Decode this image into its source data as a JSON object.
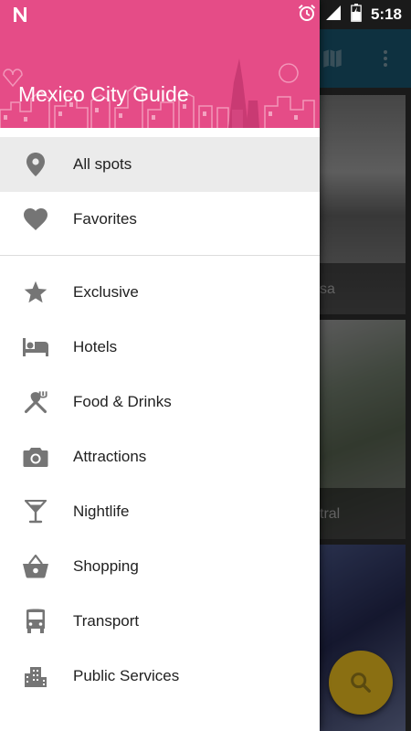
{
  "status_bar": {
    "time": "5:18",
    "icons": [
      "n-notification-icon",
      "alarm-icon",
      "signal-icon",
      "battery-icon"
    ]
  },
  "drawer": {
    "header_color": "#e54c87",
    "title": "Mexico City Guide",
    "primary_items": [
      {
        "label": "All spots",
        "icon": "location-pin-icon",
        "selected": true
      },
      {
        "label": "Favorites",
        "icon": "heart-icon",
        "selected": false
      }
    ],
    "category_items": [
      {
        "label": "Exclusive",
        "icon": "star-icon"
      },
      {
        "label": "Hotels",
        "icon": "bed-icon"
      },
      {
        "label": "Food & Drinks",
        "icon": "utensils-icon"
      },
      {
        "label": "Attractions",
        "icon": "camera-icon"
      },
      {
        "label": "Nightlife",
        "icon": "cocktail-icon"
      },
      {
        "label": "Shopping",
        "icon": "basket-icon"
      },
      {
        "label": "Transport",
        "icon": "bus-icon"
      },
      {
        "label": "Public Services",
        "icon": "buildings-icon"
      }
    ]
  },
  "background": {
    "toolbar_color": "#1f6d8f",
    "cards": [
      {
        "caption": "sa"
      },
      {
        "caption": "tral"
      },
      {
        "caption": ""
      }
    ],
    "fab_icon": "search-icon"
  }
}
